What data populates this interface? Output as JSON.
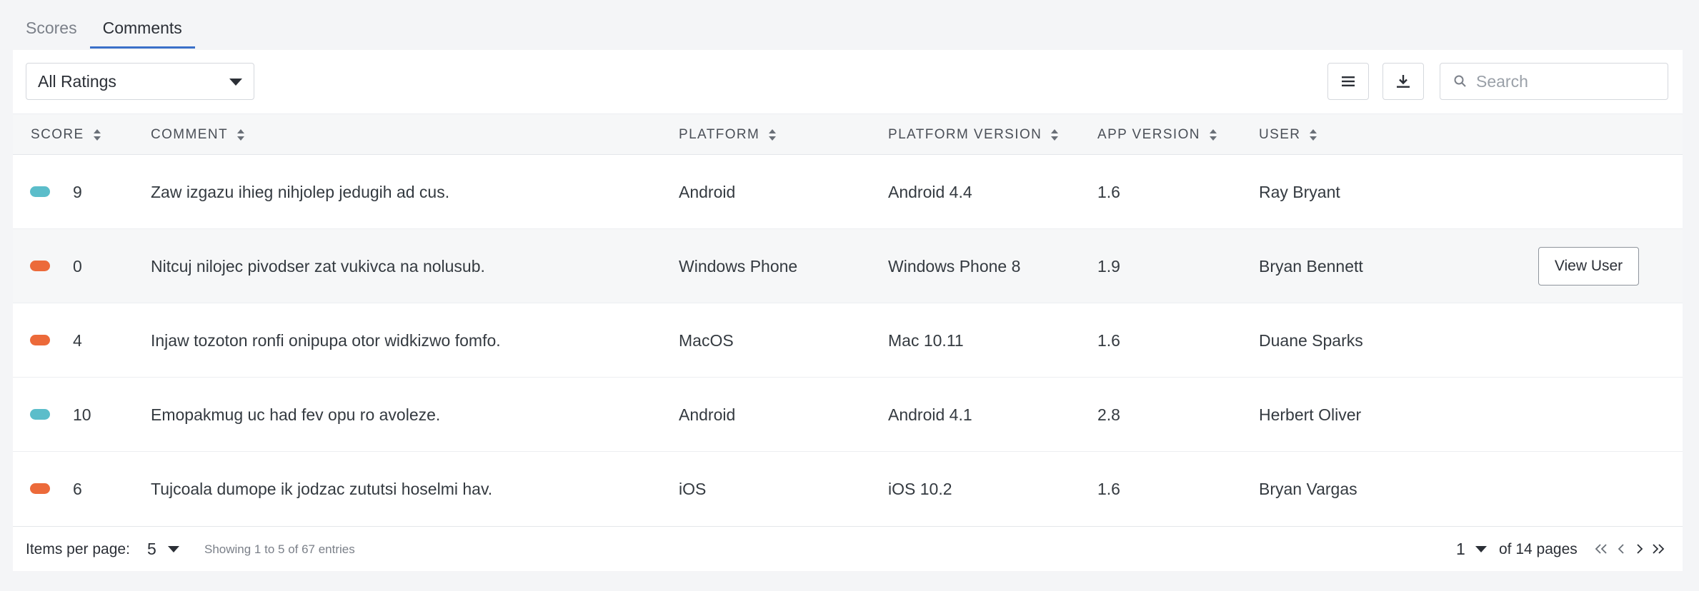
{
  "tabs": [
    {
      "label": "Scores",
      "active": false
    },
    {
      "label": "Comments",
      "active": true
    }
  ],
  "toolbar": {
    "rating_filter": "All Ratings",
    "list_icon": "list-icon",
    "download_icon": "download-icon",
    "search_placeholder": "Search"
  },
  "table": {
    "headers": {
      "score": "SCORE",
      "comment": "COMMENT",
      "platform": "PLATFORM",
      "platform_version": "PLATFORM VERSION",
      "app_version": "APP VERSION",
      "user": "USER"
    },
    "rows": [
      {
        "score": "9",
        "status": "positive",
        "color": "#5bbdca",
        "comment": "Zaw izgazu ihieg nihjolep jedugih ad cus.",
        "platform": "Android",
        "platform_version": "Android 4.4",
        "app_version": "1.6",
        "user": "Ray Bryant"
      },
      {
        "score": "0",
        "status": "negative",
        "color": "#ec6a3a",
        "comment": "Nitcuj nilojec pivodser zat vukivca na nolusub.",
        "platform": "Windows Phone",
        "platform_version": "Windows Phone 8",
        "app_version": "1.9",
        "user": "Bryan Bennett"
      },
      {
        "score": "4",
        "status": "negative",
        "color": "#ec6a3a",
        "comment": "Injaw tozoton ronfi onipupa otor widkizwo fomfo.",
        "platform": "MacOS",
        "platform_version": "Mac 10.11",
        "app_version": "1.6",
        "user": "Duane Sparks"
      },
      {
        "score": "10",
        "status": "positive",
        "color": "#5bbdca",
        "comment": "Emopakmug uc had fev opu ro avoleze.",
        "platform": "Android",
        "platform_version": "Android 4.1",
        "app_version": "2.8",
        "user": "Herbert Oliver"
      },
      {
        "score": "6",
        "status": "negative",
        "color": "#ec6a3a",
        "comment": "Tujcoala dumope ik jodzac zututsi hoselmi hav.",
        "platform": "iOS",
        "platform_version": "iOS 10.2",
        "app_version": "1.6",
        "user": "Bryan Vargas"
      }
    ],
    "row_action": "View User"
  },
  "footer": {
    "items_per_page_label": "Items per page:",
    "items_per_page": "5",
    "showing": "Showing 1 to 5 of 67 entries",
    "current_page": "1",
    "of_pages": "of 14 pages"
  }
}
